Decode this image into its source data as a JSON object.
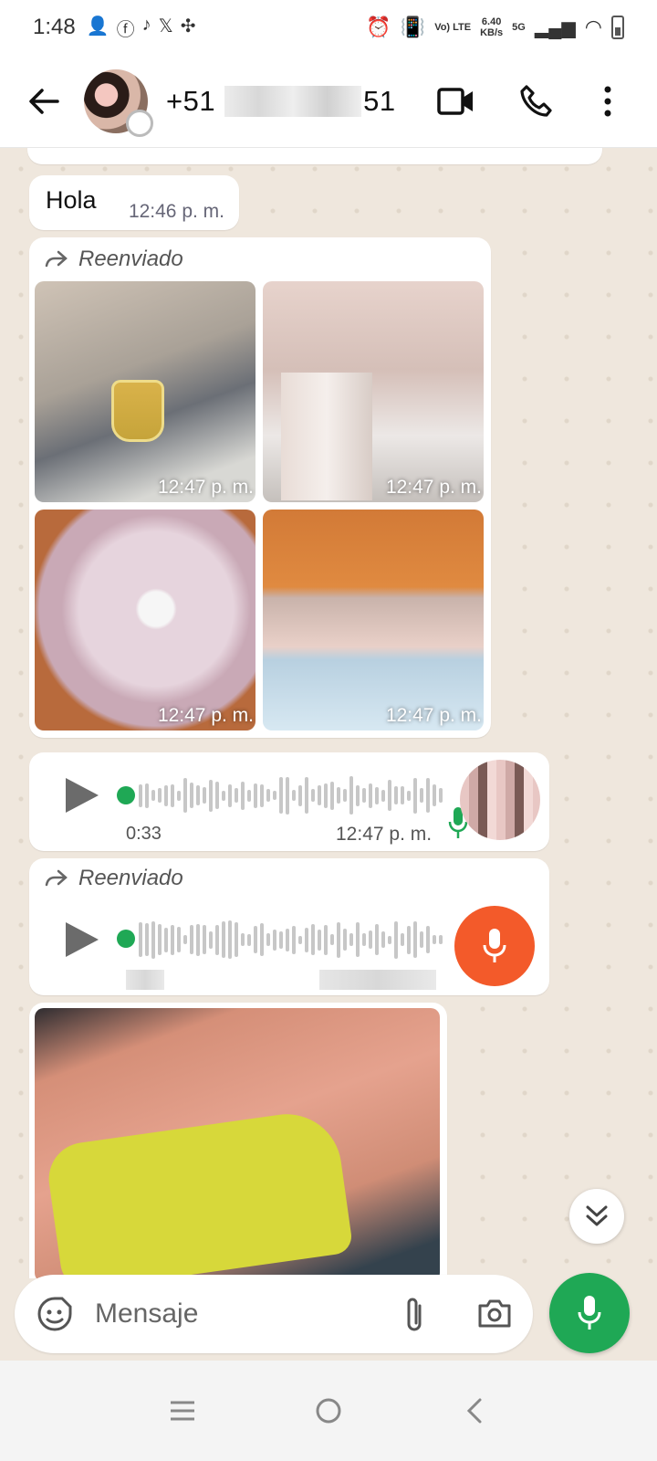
{
  "status_bar": {
    "time": "1:48",
    "net_speed": "6.40",
    "net_unit": "KB/s",
    "net_type": "5G",
    "volte": "Vo) LTE"
  },
  "header": {
    "contact_prefix": "+51",
    "contact_suffix": "51"
  },
  "messages": {
    "hola": {
      "text": "Hola",
      "time": "12:46 p. m."
    },
    "album": {
      "forwarded_label": "Reenviado",
      "photos": [
        {
          "time": "12:47 p. m."
        },
        {
          "time": "12:47 p. m."
        },
        {
          "time": "12:47 p. m."
        },
        {
          "time": "12:47 p. m."
        }
      ]
    },
    "voice1": {
      "duration": "0:33",
      "time": "12:47 p. m."
    },
    "voice2": {
      "forwarded_label": "Reenviado"
    }
  },
  "input": {
    "placeholder": "Mensaje"
  },
  "colors": {
    "accent_green": "#1fa855",
    "voice_badge_orange": "#f35a2a",
    "chat_background": "#efe7dd"
  },
  "icons": {
    "back": "arrow-left-icon",
    "video": "video-camera-icon",
    "call": "phone-icon",
    "menu": "more-vert-icon",
    "play": "play-icon",
    "mic": "mic-icon",
    "attach": "paperclip-icon",
    "camera": "camera-icon",
    "emoji": "sticker-icon",
    "scroll_down": "double-chevron-down-icon"
  }
}
